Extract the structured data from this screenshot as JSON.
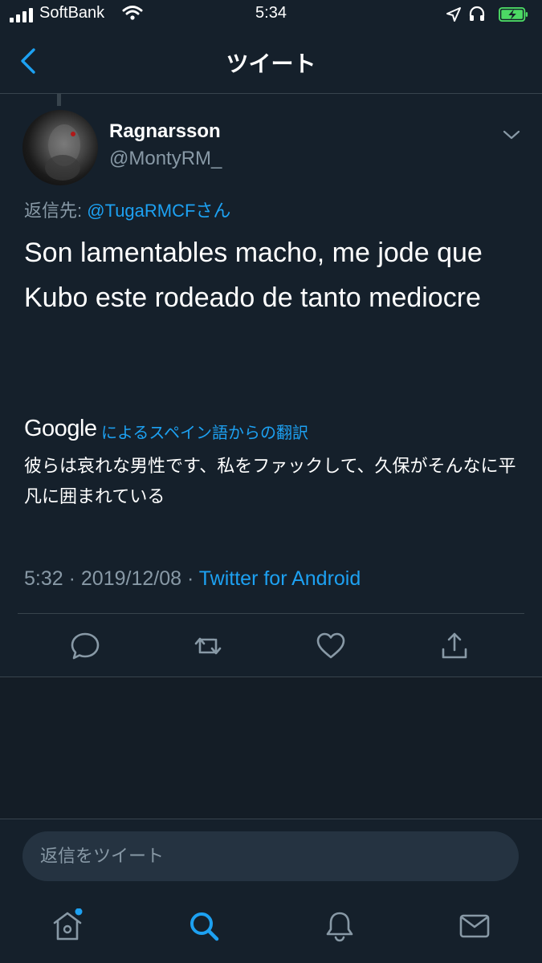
{
  "status_bar": {
    "carrier": "SoftBank",
    "time": "5:34",
    "battery_state": "charging"
  },
  "header": {
    "title": "ツイート",
    "back_icon": "chevron-left-icon"
  },
  "tweet": {
    "author_name": "Ragnarsson",
    "author_handle": "@MontyRM_",
    "reply_to_label": "返信先: ",
    "reply_to_user": "@TugaRMCFさん",
    "text": "Son lamentables macho, me jode que Kubo este rodeado de tanto mediocre",
    "translation_provider": "Google",
    "translation_label": "によるスペイン語からの翻訳",
    "translation_text": "彼らは哀れな男性です、私をファックして、久保がそんなに平凡に囲まれている",
    "time": "5:32",
    "separator": " · ",
    "date": "2019/12/08",
    "source": "Twitter for Android"
  },
  "actions": [
    {
      "name": "reply",
      "icon": "reply-icon"
    },
    {
      "name": "retweet",
      "icon": "retweet-icon"
    },
    {
      "name": "like",
      "icon": "heart-icon"
    },
    {
      "name": "share",
      "icon": "share-icon"
    }
  ],
  "reply_box": {
    "placeholder": "返信をツイート"
  },
  "tab_bar": {
    "items": [
      "home",
      "search",
      "notifications",
      "messages"
    ],
    "active": "search",
    "home_has_badge": true
  },
  "colors": {
    "background": "#15202b",
    "accent": "#1da1f2",
    "secondary_text": "#8899a6",
    "divider": "#38444d",
    "input_bg": "#253341",
    "battery": "#4cd964"
  }
}
